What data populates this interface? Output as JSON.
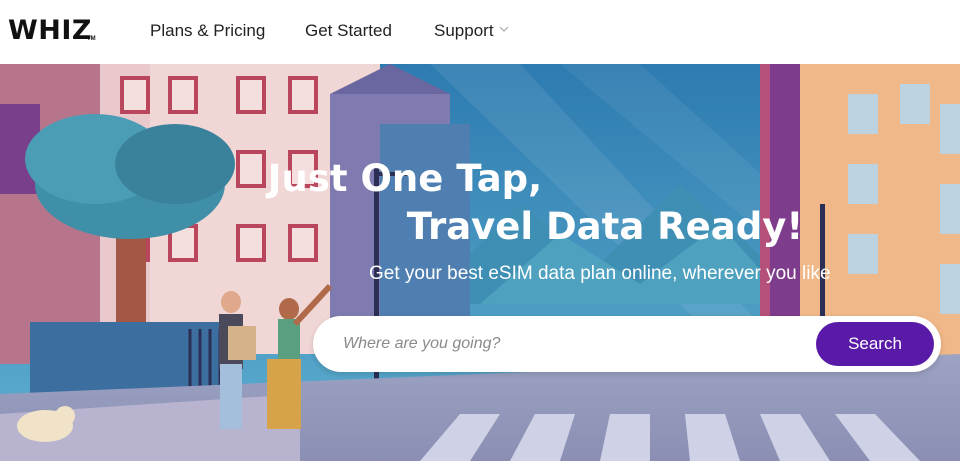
{
  "header": {
    "logo": "WHIZ",
    "logo_tm": "TM",
    "nav": {
      "plans": "Plans & Pricing",
      "get_started": "Get Started",
      "support": "Support"
    }
  },
  "hero": {
    "title_line1": "Just One Tap,",
    "title_line2": "Travel Data Ready!",
    "subtitle": "Get your best eSIM data plan online, wherever you like",
    "search": {
      "placeholder": "Where are you going?",
      "value": "",
      "button_label": "Search"
    }
  },
  "colors": {
    "brand_purple": "#5a1aa8",
    "header_bg": "#ffffff",
    "hero_text": "#ffffff"
  },
  "icons": {
    "support_dropdown": "chevron-down-icon"
  }
}
